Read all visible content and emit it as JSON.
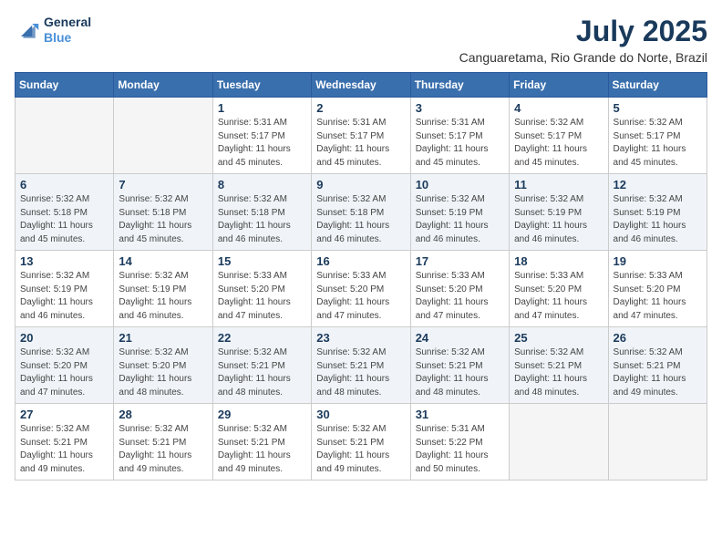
{
  "logo": {
    "line1": "General",
    "line2": "Blue"
  },
  "title": "July 2025",
  "location": "Canguaretama, Rio Grande do Norte, Brazil",
  "weekdays": [
    "Sunday",
    "Monday",
    "Tuesday",
    "Wednesday",
    "Thursday",
    "Friday",
    "Saturday"
  ],
  "weeks": [
    [
      {
        "day": "",
        "info": ""
      },
      {
        "day": "",
        "info": ""
      },
      {
        "day": "1",
        "info": "Sunrise: 5:31 AM\nSunset: 5:17 PM\nDaylight: 11 hours and 45 minutes."
      },
      {
        "day": "2",
        "info": "Sunrise: 5:31 AM\nSunset: 5:17 PM\nDaylight: 11 hours and 45 minutes."
      },
      {
        "day": "3",
        "info": "Sunrise: 5:31 AM\nSunset: 5:17 PM\nDaylight: 11 hours and 45 minutes."
      },
      {
        "day": "4",
        "info": "Sunrise: 5:32 AM\nSunset: 5:17 PM\nDaylight: 11 hours and 45 minutes."
      },
      {
        "day": "5",
        "info": "Sunrise: 5:32 AM\nSunset: 5:17 PM\nDaylight: 11 hours and 45 minutes."
      }
    ],
    [
      {
        "day": "6",
        "info": "Sunrise: 5:32 AM\nSunset: 5:18 PM\nDaylight: 11 hours and 45 minutes."
      },
      {
        "day": "7",
        "info": "Sunrise: 5:32 AM\nSunset: 5:18 PM\nDaylight: 11 hours and 45 minutes."
      },
      {
        "day": "8",
        "info": "Sunrise: 5:32 AM\nSunset: 5:18 PM\nDaylight: 11 hours and 46 minutes."
      },
      {
        "day": "9",
        "info": "Sunrise: 5:32 AM\nSunset: 5:18 PM\nDaylight: 11 hours and 46 minutes."
      },
      {
        "day": "10",
        "info": "Sunrise: 5:32 AM\nSunset: 5:19 PM\nDaylight: 11 hours and 46 minutes."
      },
      {
        "day": "11",
        "info": "Sunrise: 5:32 AM\nSunset: 5:19 PM\nDaylight: 11 hours and 46 minutes."
      },
      {
        "day": "12",
        "info": "Sunrise: 5:32 AM\nSunset: 5:19 PM\nDaylight: 11 hours and 46 minutes."
      }
    ],
    [
      {
        "day": "13",
        "info": "Sunrise: 5:32 AM\nSunset: 5:19 PM\nDaylight: 11 hours and 46 minutes."
      },
      {
        "day": "14",
        "info": "Sunrise: 5:32 AM\nSunset: 5:19 PM\nDaylight: 11 hours and 46 minutes."
      },
      {
        "day": "15",
        "info": "Sunrise: 5:33 AM\nSunset: 5:20 PM\nDaylight: 11 hours and 47 minutes."
      },
      {
        "day": "16",
        "info": "Sunrise: 5:33 AM\nSunset: 5:20 PM\nDaylight: 11 hours and 47 minutes."
      },
      {
        "day": "17",
        "info": "Sunrise: 5:33 AM\nSunset: 5:20 PM\nDaylight: 11 hours and 47 minutes."
      },
      {
        "day": "18",
        "info": "Sunrise: 5:33 AM\nSunset: 5:20 PM\nDaylight: 11 hours and 47 minutes."
      },
      {
        "day": "19",
        "info": "Sunrise: 5:33 AM\nSunset: 5:20 PM\nDaylight: 11 hours and 47 minutes."
      }
    ],
    [
      {
        "day": "20",
        "info": "Sunrise: 5:32 AM\nSunset: 5:20 PM\nDaylight: 11 hours and 47 minutes."
      },
      {
        "day": "21",
        "info": "Sunrise: 5:32 AM\nSunset: 5:20 PM\nDaylight: 11 hours and 48 minutes."
      },
      {
        "day": "22",
        "info": "Sunrise: 5:32 AM\nSunset: 5:21 PM\nDaylight: 11 hours and 48 minutes."
      },
      {
        "day": "23",
        "info": "Sunrise: 5:32 AM\nSunset: 5:21 PM\nDaylight: 11 hours and 48 minutes."
      },
      {
        "day": "24",
        "info": "Sunrise: 5:32 AM\nSunset: 5:21 PM\nDaylight: 11 hours and 48 minutes."
      },
      {
        "day": "25",
        "info": "Sunrise: 5:32 AM\nSunset: 5:21 PM\nDaylight: 11 hours and 48 minutes."
      },
      {
        "day": "26",
        "info": "Sunrise: 5:32 AM\nSunset: 5:21 PM\nDaylight: 11 hours and 49 minutes."
      }
    ],
    [
      {
        "day": "27",
        "info": "Sunrise: 5:32 AM\nSunset: 5:21 PM\nDaylight: 11 hours and 49 minutes."
      },
      {
        "day": "28",
        "info": "Sunrise: 5:32 AM\nSunset: 5:21 PM\nDaylight: 11 hours and 49 minutes."
      },
      {
        "day": "29",
        "info": "Sunrise: 5:32 AM\nSunset: 5:21 PM\nDaylight: 11 hours and 49 minutes."
      },
      {
        "day": "30",
        "info": "Sunrise: 5:32 AM\nSunset: 5:21 PM\nDaylight: 11 hours and 49 minutes."
      },
      {
        "day": "31",
        "info": "Sunrise: 5:31 AM\nSunset: 5:22 PM\nDaylight: 11 hours and 50 minutes."
      },
      {
        "day": "",
        "info": ""
      },
      {
        "day": "",
        "info": ""
      }
    ]
  ]
}
